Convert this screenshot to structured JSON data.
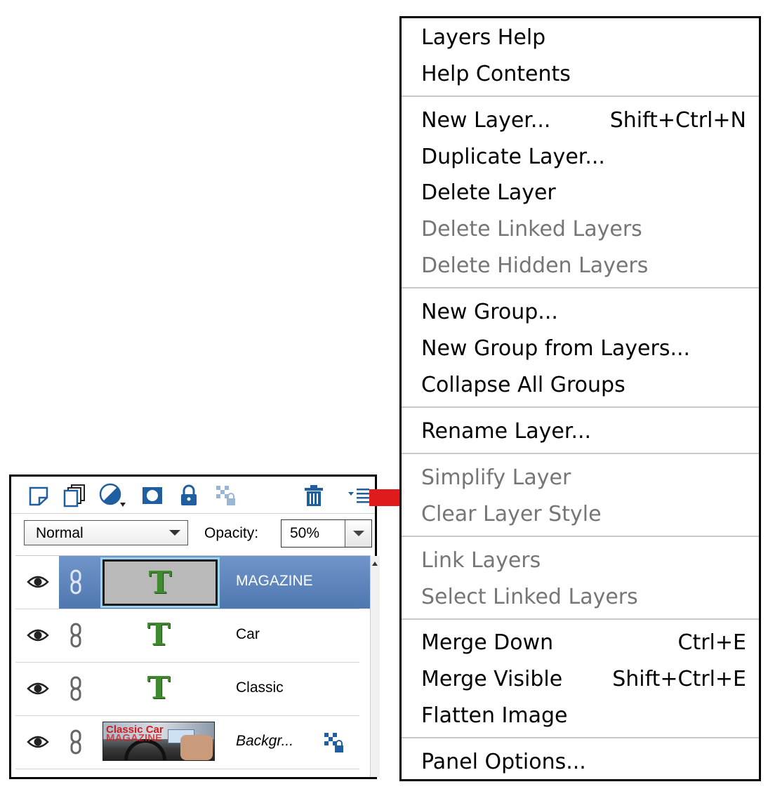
{
  "layers_panel": {
    "blend_mode": "Normal",
    "opacity_label": "Opacity:",
    "opacity_value": "50%",
    "toolbar_icons": [
      "new-layer-icon",
      "new-group-icon",
      "adjustment-layer-icon",
      "layer-mask-icon",
      "lock-all-icon",
      "lock-transparency-icon",
      "trash-icon",
      "panel-menu-icon"
    ],
    "layers": [
      {
        "name": "MAGAZINE",
        "type": "text",
        "selected": true,
        "thumb_glyph": "T"
      },
      {
        "name": "Car",
        "type": "text",
        "selected": false,
        "thumb_glyph": "T"
      },
      {
        "name": "Classic",
        "type": "text",
        "selected": false,
        "thumb_glyph": "T"
      },
      {
        "name": "Backgr...",
        "type": "image",
        "selected": false,
        "thumb_text_1": "Classic Car",
        "thumb_text_2": "MAGAZINE"
      }
    ]
  },
  "menu": {
    "items": [
      {
        "label": "Layers Help",
        "enabled": true
      },
      {
        "label": "Help Contents",
        "enabled": true
      },
      {
        "label": "New Layer...",
        "shortcut": "Shift+Ctrl+N",
        "enabled": true
      },
      {
        "label": "Duplicate Layer...",
        "enabled": true
      },
      {
        "label": "Delete Layer",
        "enabled": true
      },
      {
        "label": "Delete Linked Layers",
        "enabled": false
      },
      {
        "label": "Delete Hidden Layers",
        "enabled": false
      },
      {
        "label": "New Group...",
        "enabled": true
      },
      {
        "label": "New Group from Layers...",
        "enabled": true
      },
      {
        "label": "Collapse All Groups",
        "enabled": true
      },
      {
        "label": "Rename Layer...",
        "enabled": true
      },
      {
        "label": "Simplify Layer",
        "enabled": false
      },
      {
        "label": "Clear Layer Style",
        "enabled": false
      },
      {
        "label": "Link Layers",
        "enabled": false
      },
      {
        "label": "Select Linked Layers",
        "enabled": false
      },
      {
        "label": "Merge Down",
        "shortcut": "Ctrl+E",
        "enabled": true
      },
      {
        "label": "Merge Visible",
        "shortcut": "Shift+Ctrl+E",
        "enabled": true
      },
      {
        "label": "Flatten Image",
        "enabled": true
      },
      {
        "label": "Panel Options...",
        "enabled": true
      }
    ]
  },
  "colors": {
    "selected_row": "#5a82bb",
    "arrow": "#e01b1b",
    "text_glyph": "#3e8a2c",
    "disabled_text": "#767676"
  }
}
